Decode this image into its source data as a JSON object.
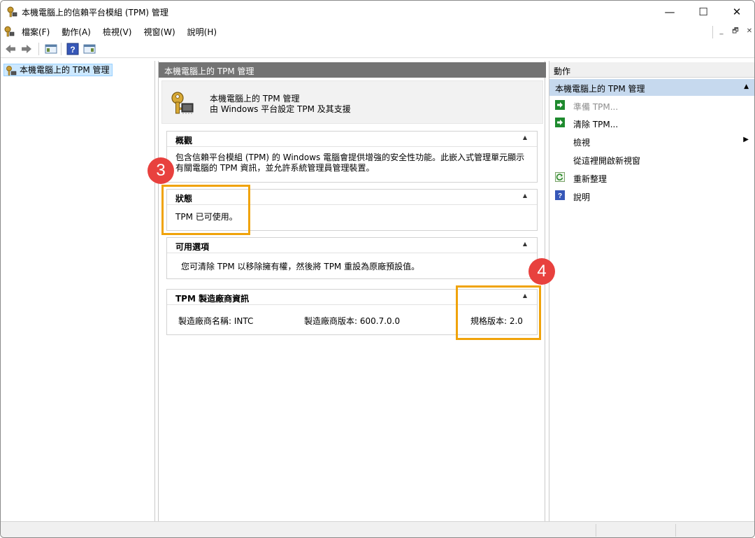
{
  "window": {
    "title": "本機電腦上的信賴平台模組 (TPM) 管理",
    "min_glyph": "—",
    "max_glyph": "☐",
    "close_glyph": "✕"
  },
  "menu": {
    "items": [
      "檔案(F)",
      "動作(A)",
      "檢視(V)",
      "視窗(W)",
      "說明(H)"
    ],
    "mdi": [
      "_",
      "🗗",
      "✕"
    ]
  },
  "tree": {
    "root_label": "本機電腦上的 TPM 管理"
  },
  "middle": {
    "header": "本機電腦上的 TPM 管理",
    "intro_line1": "本機電腦上的 TPM 管理",
    "intro_line2": "由 Windows 平台設定 TPM 及其支援",
    "sections": {
      "overview": {
        "title": "概觀",
        "body": "包含信賴平台模組 (TPM) 的 Windows 電腦會提供增強的安全性功能。此嵌入式管理單元顯示有關電腦的 TPM 資訊，並允許系統管理員管理裝置。"
      },
      "status": {
        "title": "狀態",
        "body": "TPM 已可使用。"
      },
      "options": {
        "title": "可用選項",
        "body": "您可清除 TPM 以移除擁有權，然後將 TPM 重設為原廠預設值。"
      },
      "vendor": {
        "title": "TPM 製造廠商資訊",
        "name_label": "製造廠商名稱:  INTC",
        "version_label": "製造廠商版本:  600.7.0.0",
        "spec_label": "規格版本:  2.0"
      }
    },
    "caret": "▲"
  },
  "actions": {
    "header": "動作",
    "group": "本機電腦上的 TPM 管理",
    "items": {
      "prepare": "準備 TPM...",
      "clear": "清除 TPM...",
      "view": "檢視",
      "new_window": "從這裡開啟新視窗",
      "refresh": "重新整理",
      "help": "說明"
    }
  },
  "annotations": {
    "badge3": "3",
    "badge4": "4",
    "color": "#f0a30a",
    "badge_color": "#e8413e"
  }
}
